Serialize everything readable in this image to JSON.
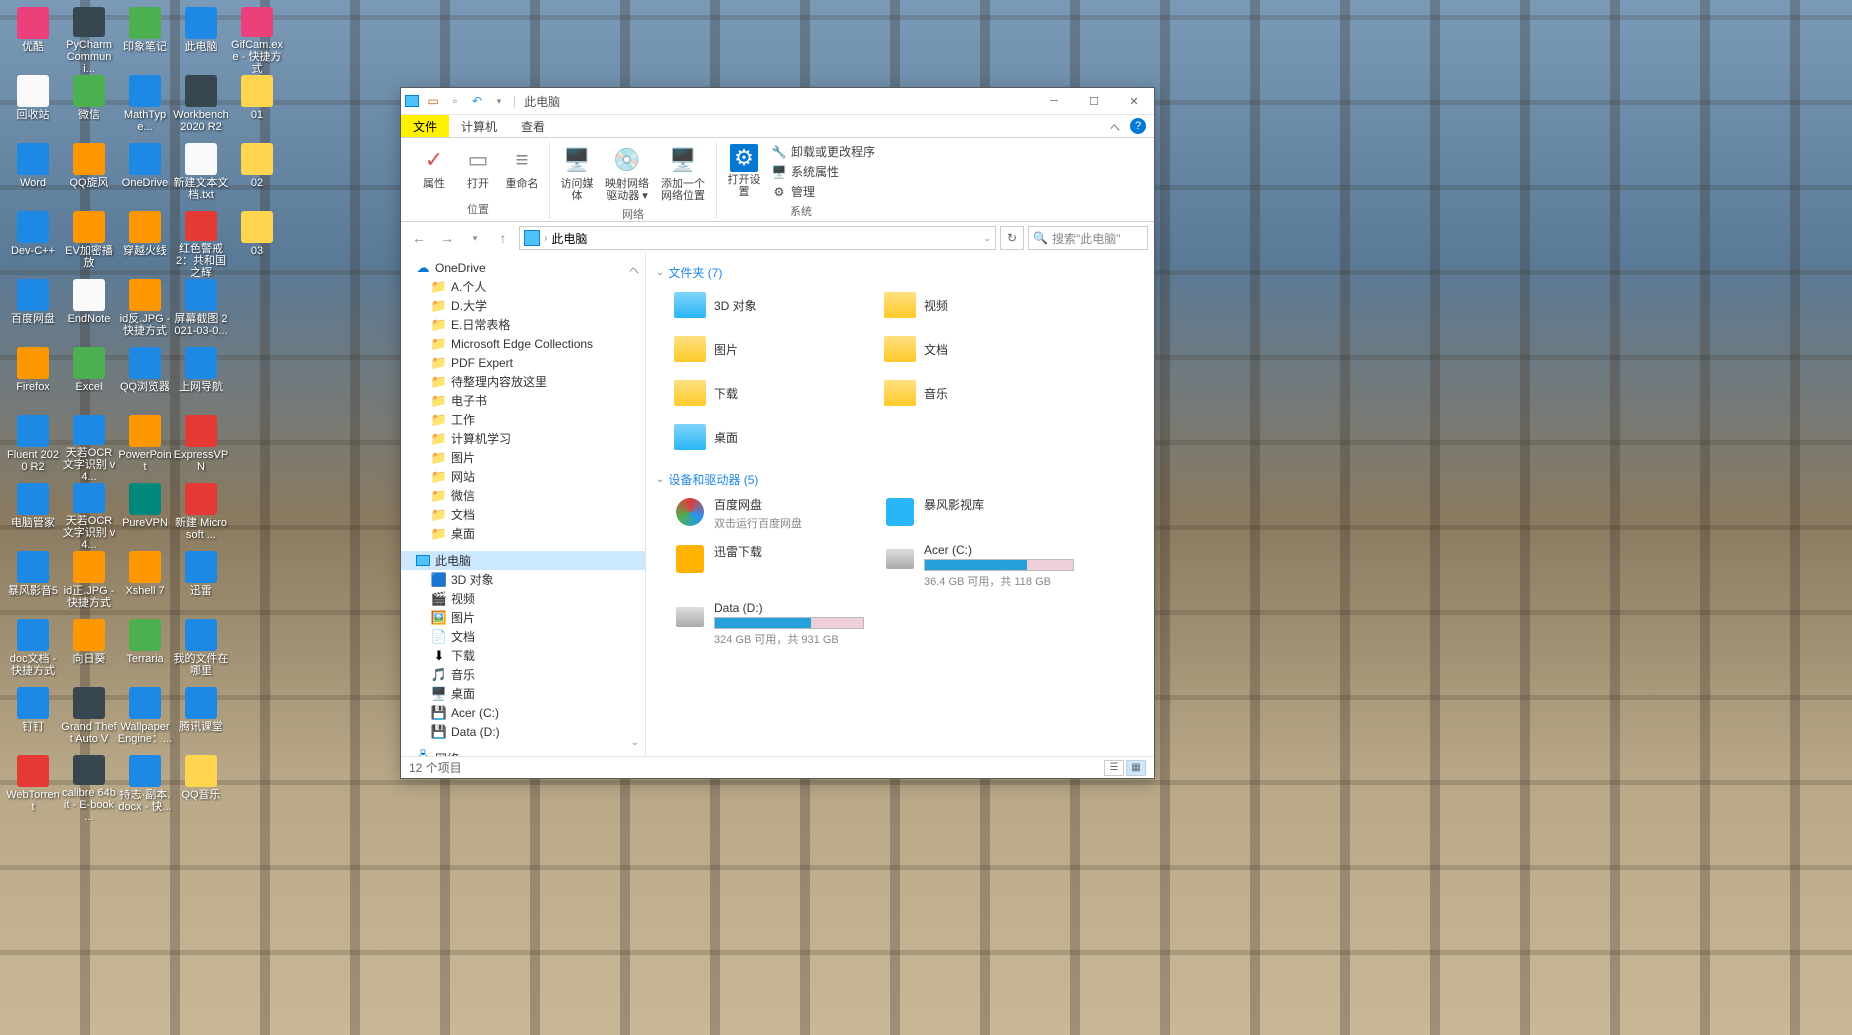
{
  "desktop_icons": [
    {
      "label": "优酷",
      "color": "i-pink"
    },
    {
      "label": "PyCharm Communi...",
      "color": "i-dark"
    },
    {
      "label": "印象笔记",
      "color": "i-green"
    },
    {
      "label": "此电脑",
      "color": "i-blue"
    },
    {
      "label": "GifCam.exe - 快捷方式",
      "color": "i-pink"
    },
    {
      "label": "回收站",
      "color": "i-white"
    },
    {
      "label": "微信",
      "color": "i-green"
    },
    {
      "label": "MathType...",
      "color": "i-blue"
    },
    {
      "label": "Workbench 2020 R2",
      "color": "i-dark"
    },
    {
      "label": "01",
      "color": "i-yellow"
    },
    {
      "label": "Word",
      "color": "i-blue"
    },
    {
      "label": "QQ旋风",
      "color": "i-orange"
    },
    {
      "label": "OneDrive",
      "color": "i-blue"
    },
    {
      "label": "新建文本文档.txt",
      "color": "i-white"
    },
    {
      "label": "02",
      "color": "i-yellow"
    },
    {
      "label": "Dev-C++",
      "color": "i-blue"
    },
    {
      "label": "EV加密播放",
      "color": "i-orange"
    },
    {
      "label": "穿越火线",
      "color": "i-orange"
    },
    {
      "label": "红色警戒2：共和国之辉",
      "color": "i-red"
    },
    {
      "label": "03",
      "color": "i-yellow"
    },
    {
      "label": "百度网盘",
      "color": "i-blue"
    },
    {
      "label": "EndNote",
      "color": "i-white"
    },
    {
      "label": "id反.JPG - 快捷方式",
      "color": "i-orange"
    },
    {
      "label": "屏幕截图 2021-03-0...",
      "color": "i-blue"
    },
    {
      "label": "",
      "color": ""
    },
    {
      "label": "Firefox",
      "color": "i-orange"
    },
    {
      "label": "Excel",
      "color": "i-green"
    },
    {
      "label": "QQ浏览器",
      "color": "i-blue"
    },
    {
      "label": "上网导航",
      "color": "i-blue"
    },
    {
      "label": "",
      "color": ""
    },
    {
      "label": "Fluent 2020 R2",
      "color": "i-blue"
    },
    {
      "label": "天若OCR文字识别 v4...",
      "color": "i-blue"
    },
    {
      "label": "PowerPoint",
      "color": "i-orange"
    },
    {
      "label": "ExpressVPN",
      "color": "i-red"
    },
    {
      "label": "",
      "color": ""
    },
    {
      "label": "电脑管家",
      "color": "i-blue"
    },
    {
      "label": "天若OCR文字识别 v4...",
      "color": "i-blue"
    },
    {
      "label": "PureVPN",
      "color": "i-teal"
    },
    {
      "label": "新建 Microsoft ...",
      "color": "i-red"
    },
    {
      "label": "",
      "color": ""
    },
    {
      "label": "暴风影音5",
      "color": "i-blue"
    },
    {
      "label": "id正.JPG - 快捷方式",
      "color": "i-orange"
    },
    {
      "label": "Xshell 7",
      "color": "i-orange"
    },
    {
      "label": "迅雷",
      "color": "i-blue"
    },
    {
      "label": "",
      "color": ""
    },
    {
      "label": "doc文档 - 快捷方式",
      "color": "i-blue"
    },
    {
      "label": "向日葵",
      "color": "i-orange"
    },
    {
      "label": "Terraria",
      "color": "i-green"
    },
    {
      "label": "我的文件在哪里",
      "color": "i-blue"
    },
    {
      "label": "",
      "color": ""
    },
    {
      "label": "钉钉",
      "color": "i-blue"
    },
    {
      "label": "Grand Theft Auto V",
      "color": "i-dark"
    },
    {
      "label": "Wallpaper Engine：...",
      "color": "i-blue"
    },
    {
      "label": "腾讯课堂",
      "color": "i-blue"
    },
    {
      "label": "",
      "color": ""
    },
    {
      "label": "WebTorrent",
      "color": "i-red"
    },
    {
      "label": "calibre 64bit - E-book ...",
      "color": "i-dark"
    },
    {
      "label": "持志·副本.docx - 快...",
      "color": "i-blue"
    },
    {
      "label": "QQ音乐",
      "color": "i-yellow"
    }
  ],
  "window": {
    "title": "此电脑",
    "tabs": {
      "file": "文件",
      "computer": "计算机",
      "view": "查看"
    },
    "ribbon": {
      "properties": "属性",
      "open": "打开",
      "rename": "重命名",
      "access_media": "访问媒体",
      "map_drive": "映射网络驱动器 ▾",
      "add_network": "添加一个网络位置",
      "open_settings": "打开设置",
      "uninstall": "卸载或更改程序",
      "sys_properties": "系统属性",
      "manage": "管理",
      "group_location": "位置",
      "group_network": "网络",
      "group_system": "系统"
    },
    "address": {
      "path": "此电脑",
      "search_hint": "搜索\"此电脑\""
    },
    "nav": {
      "onedrive": "OneDrive",
      "folders": [
        "A.个人",
        "D.大学",
        "E.日常表格",
        "Microsoft Edge Collections",
        "PDF Expert",
        "待整理内容放这里",
        "电子书",
        "工作",
        "计算机学习",
        "图片",
        "网站",
        "微信",
        "文档",
        "桌面"
      ],
      "this_pc": "此电脑",
      "pc_items": [
        "3D 对象",
        "视频",
        "图片",
        "文档",
        "下载",
        "音乐",
        "桌面",
        "Acer (C:)",
        "Data (D:)"
      ],
      "network": "网络"
    },
    "sections": {
      "folders_header": "文件夹 (7)",
      "drives_header": "设备和驱动器 (5)"
    },
    "folders": [
      {
        "name": "3D 对象"
      },
      {
        "name": "视频"
      },
      {
        "name": "图片"
      },
      {
        "name": "文档"
      },
      {
        "name": "下载"
      },
      {
        "name": "音乐"
      },
      {
        "name": "桌面"
      }
    ],
    "drives": [
      {
        "name": "百度网盘",
        "sub": "双击运行百度网盘",
        "type": "app"
      },
      {
        "name": "暴风影视库",
        "type": "app2"
      },
      {
        "name": "迅雷下载",
        "type": "app3"
      },
      {
        "name": "Acer (C:)",
        "sub": "36.4 GB 可用，共 118 GB",
        "type": "disk",
        "fill": 69
      },
      {
        "name": "Data (D:)",
        "sub": "324 GB 可用，共 931 GB",
        "type": "disk",
        "fill": 65
      }
    ],
    "status": "12 个项目"
  }
}
